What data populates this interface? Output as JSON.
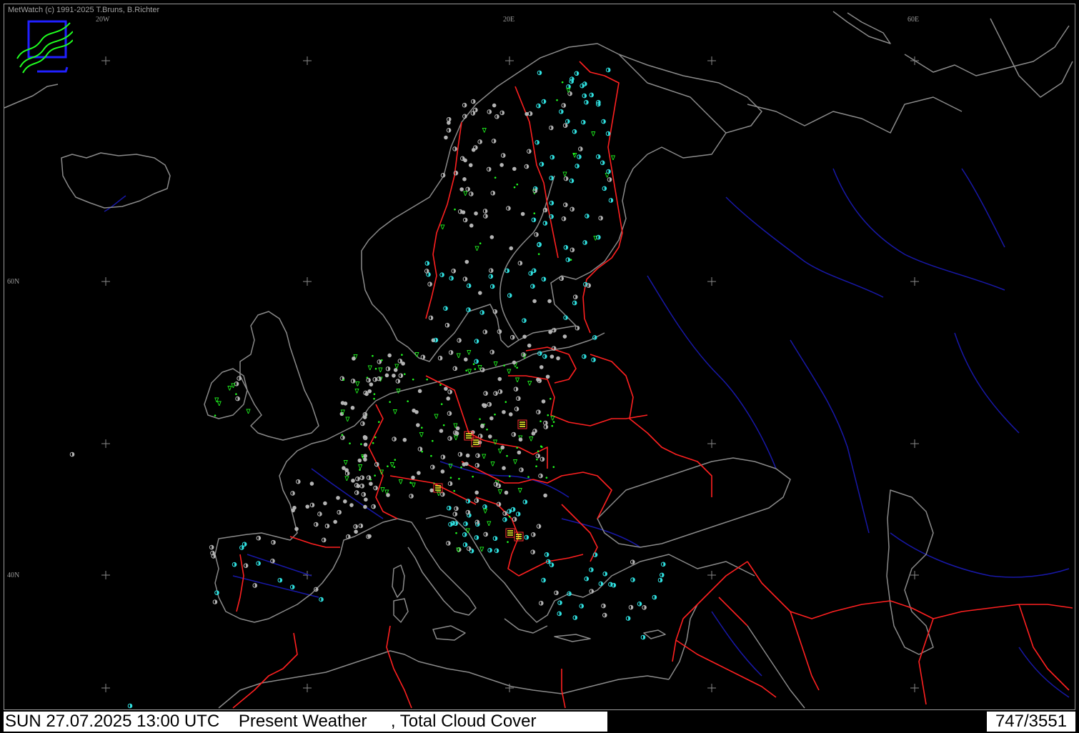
{
  "copyright": "MetWatch  (c) 1991-2025 T.Bruns, B.Richter",
  "coords": {
    "lon_20w": "20W",
    "lon_20e": "20E",
    "lon_60e": "60E",
    "lat_60n": "60N",
    "lat_40n": "40N"
  },
  "status": {
    "datetime": "SUN 27.07.2025 13:00 UTC",
    "product": "Present Weather",
    "parameter": ", Total Cloud Cover",
    "count": "747/3551"
  },
  "colors": {
    "background": "#000000",
    "coastline": "#8a8a8a",
    "borders": "#ff2020",
    "rivers": "#1818a8",
    "clear_station": "#30e0e0",
    "cloudy_station": "#b4b4b4",
    "rain_symbol": "#20ff20",
    "thunder_symbol": "#ffff30"
  }
}
